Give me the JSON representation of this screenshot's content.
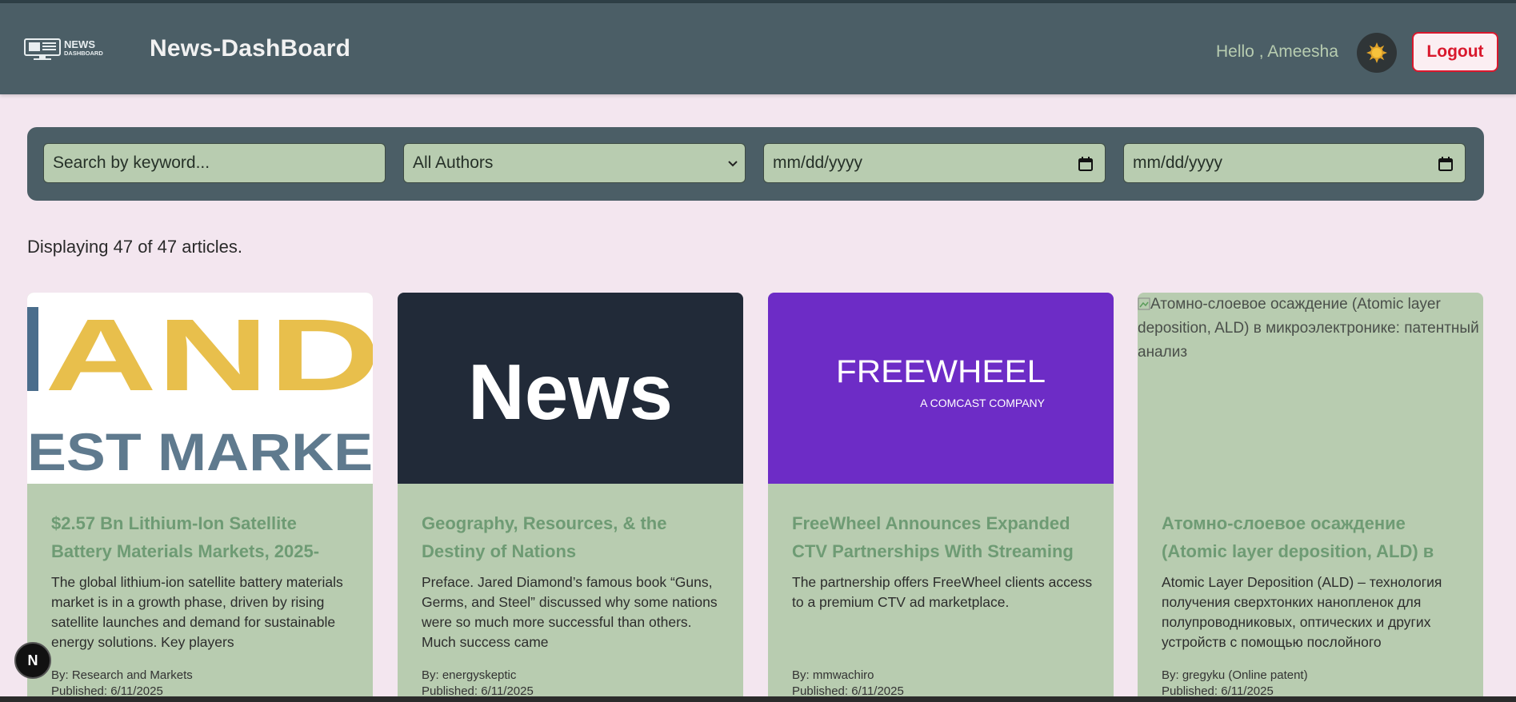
{
  "header": {
    "logo_text_line1": "NEWS",
    "logo_text_line2": "DASHBOARD",
    "app_title": "News-DashBoard",
    "greeting": "Hello , Ameesha",
    "theme_icon": "sun-icon",
    "logout_label": "Logout",
    "colors": {
      "header_bg": "#4b5e66",
      "logout": "#d9182d",
      "greeting": "#b7ccb0"
    }
  },
  "filters": {
    "search_placeholder": "Search by keyword...",
    "author_selected": "All Authors",
    "start_date_placeholder": "mm/dd/yyyy",
    "end_date_placeholder": "mm/dd/yyyy"
  },
  "summary": {
    "text": "Displaying 47 of 47 articles."
  },
  "articles": [
    {
      "image_words_1": "AND",
      "image_words_2": "EST MARKE",
      "title": "$2.57 Bn Lithium-Ion Satellite Battery Materials Markets, 2025-",
      "description": "The global lithium-ion satellite battery materials market is in a growth phase, driven by rising satellite launches and demand for sustainable energy solutions. Key players",
      "author": "By: Research and Markets",
      "published": "Published: 6/11/2025"
    },
    {
      "image_text": "News",
      "title": "Geography, Resources, & the Destiny of Nations",
      "description": "Preface. Jared Diamond’s famous book “Guns, Germs, and Steel” discussed why some nations were so much more successful than others. Much success came",
      "author": "By: energyskeptic",
      "published": "Published: 6/11/2025"
    },
    {
      "image_text": "FREEWHEEL",
      "image_subtext": "A COMCAST COMPANY",
      "title": "FreeWheel Announces Expanded CTV Partnerships With Streaming",
      "description": "The partnership offers FreeWheel clients access to a premium CTV ad marketplace.",
      "author": "By: mmwachiro",
      "published": "Published: 6/11/2025"
    },
    {
      "image_alt": "Атомно-слоевое осаждение (Atomic layer deposition, ALD) в микроэлектронике: патентный анализ",
      "title": "Атомно-слоевое осаждение (Atomic layer deposition, ALD) в",
      "description": "Atomic Layer Deposition (ALD) – технология получения сверхтонких нанопленок для полупроводниковых, оптических и других устройств с помощью послойного",
      "author": "By: gregyku (Online patent)",
      "published": "Published: 6/11/2025"
    }
  ],
  "devtools_badge": "N"
}
